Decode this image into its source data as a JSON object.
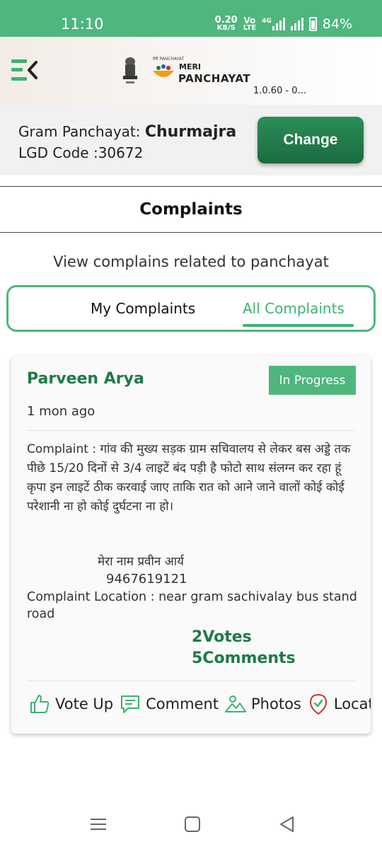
{
  "status_bar": {
    "time": "11:10",
    "speed_value": "0.20",
    "speed_unit": "KB/S",
    "volte_top": "Vo",
    "volte_bottom": "LTE",
    "network": "4G",
    "battery": "84%"
  },
  "header": {
    "logo_small": "मेरी PANCHAYAT",
    "logo_meri": "MERI",
    "logo_name": "PANCHAYAT",
    "version": "1.0.60 - 0..."
  },
  "panchayat": {
    "label": "Gram Panchayat: ",
    "name": "Churmajra",
    "lgd": "LGD Code :30672",
    "change_label": "Change"
  },
  "page": {
    "title": "Complaints",
    "subtitle": "View complains related to panchayat"
  },
  "tabs": {
    "my": "My Complaints",
    "all": "All Complaints",
    "selected": "All Complaints"
  },
  "complaint": {
    "author": "Parveen Arya",
    "status": "In Progress",
    "time": "1 mon ago",
    "text": "Complaint : गांव की मुख्य सड़क ग्राम सचिवालय से लेकर बस अड्डे तक पीछे 15/20 दिनों से 3/4 लाइटें बंद पड़ी है फोटो साथ संलग्न कर रहा हूं कृपा इन लाइटें ठीक करवाई जाए ताकि रात को आने जाने वालों कोई कोई परेशानी ना हो कोई दुर्घटना ना हो।",
    "signature_name": "मेरा नाम प्रवीन आर्य",
    "signature_phone": "9467619121",
    "location": "Complaint Location : near gram sachivalay bus stand road",
    "votes": "2Votes",
    "comments": "5Comments",
    "actions": {
      "vote_up": "Vote Up",
      "comment": "Comment",
      "photos": "Photos",
      "location": "Location"
    }
  },
  "colors": {
    "accent": "#4fb67e",
    "primary_dark": "#1e7a48",
    "button": "#217a47"
  },
  "icons": [
    "menu-back-icon",
    "emblem-icon",
    "logo-bowl-icon",
    "thumbs-up-icon",
    "comment-icon",
    "photos-icon",
    "location-check-icon",
    "nav-recents-icon",
    "nav-home-icon",
    "nav-back-icon"
  ]
}
